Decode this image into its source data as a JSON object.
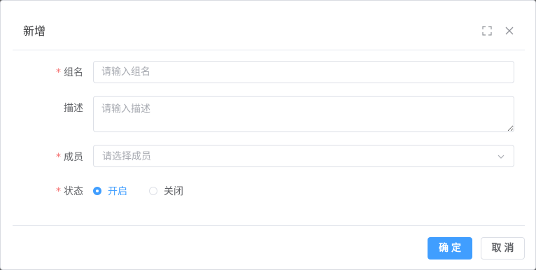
{
  "dialog": {
    "title": "新增",
    "icons": {
      "fullscreen": "fullscreen-icon",
      "close": "close-icon"
    }
  },
  "form": {
    "required_mark": "*",
    "group_name": {
      "label": "组名",
      "placeholder": "请输入组名",
      "value": ""
    },
    "description": {
      "label": "描述",
      "placeholder": "请输入描述",
      "value": ""
    },
    "members": {
      "label": "成员",
      "placeholder": "请选择成员",
      "arrow_icon": "chevron-down-icon"
    },
    "status": {
      "label": "状态",
      "options": [
        {
          "label": "开启",
          "checked": true
        },
        {
          "label": "关闭",
          "checked": false
        }
      ]
    }
  },
  "footer": {
    "confirm_label": "确定",
    "cancel_label": "取消"
  },
  "colors": {
    "primary": "#409eff",
    "required": "#f56c6c",
    "text": "#606266",
    "placeholder": "#a8abb2",
    "border": "#dcdfe6"
  }
}
